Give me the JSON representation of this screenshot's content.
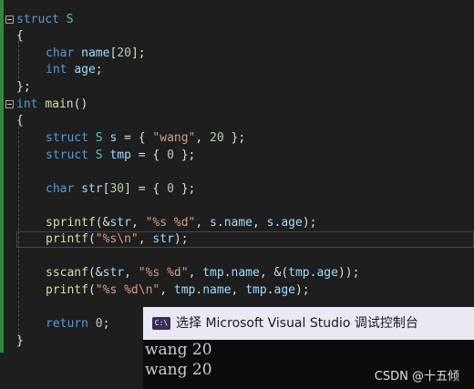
{
  "editor": {
    "tokens": {
      "struct": "struct",
      "S": "S",
      "char": "char",
      "int": "int",
      "name": "name",
      "age": "age",
      "main": "main",
      "s": "s",
      "tmp": "tmp",
      "str": "str",
      "sprintf": "sprintf",
      "printf": "printf",
      "sscanf": "sscanf",
      "return": "return",
      "n20": "20",
      "n30": "30",
      "n0": "0",
      "wang": "\"wang\"",
      "fmt1": "\"%s %d\"",
      "fmt2": "\"%s\\n\"",
      "fmt3": "\"%s %d\\n\""
    }
  },
  "console": {
    "icon": "C:\\",
    "title": "选择 Microsoft Visual Studio 调试控制台",
    "lines": [
      "wang 20",
      "wang 20"
    ]
  },
  "watermark": "CSDN @十五倾"
}
